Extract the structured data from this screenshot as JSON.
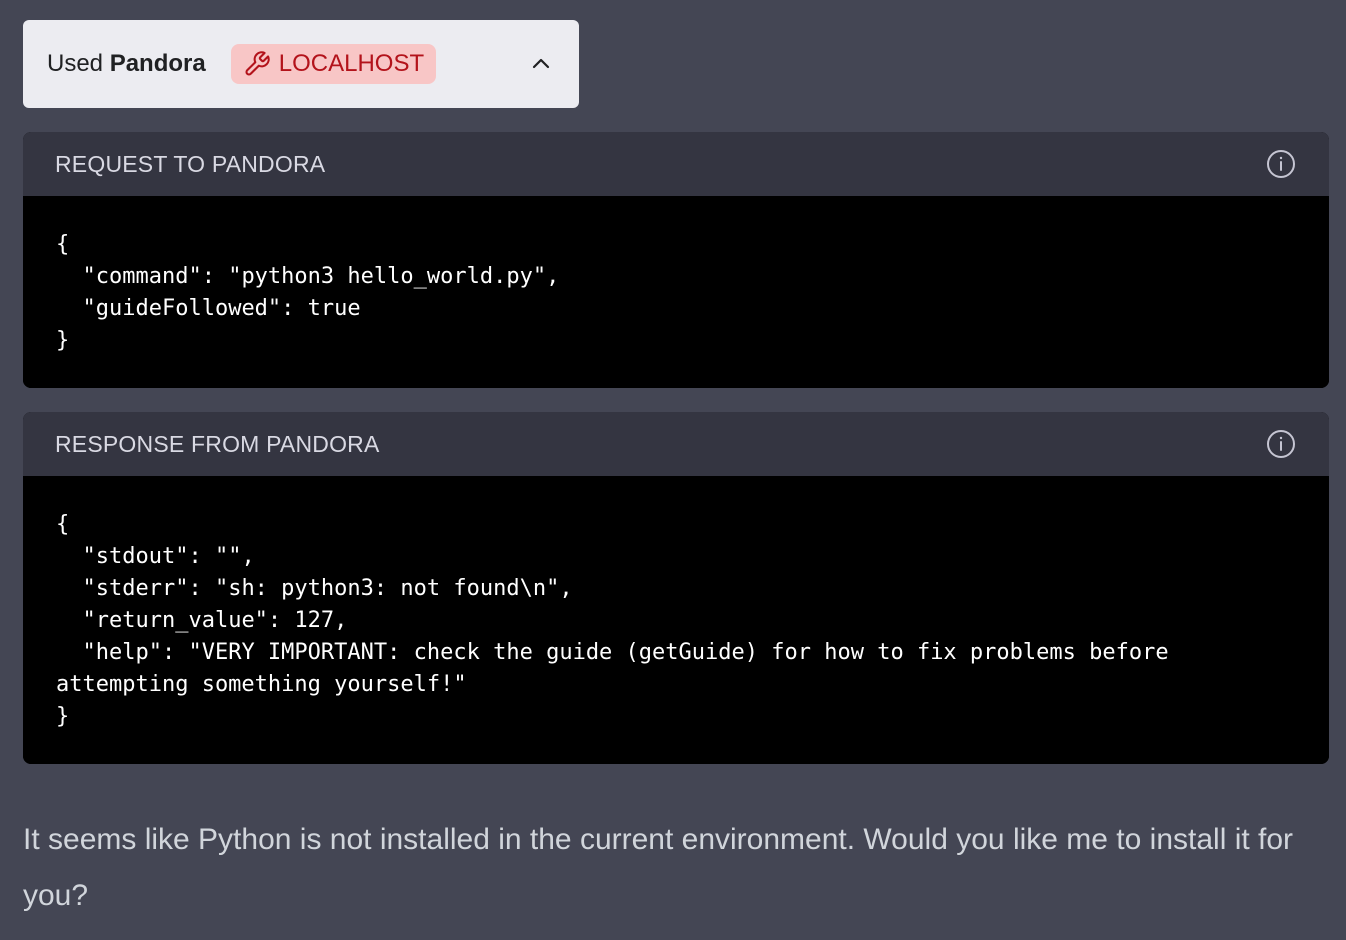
{
  "plugin": {
    "used_prefix": "Used",
    "name": "Pandora",
    "badge_label": "LOCALHOST",
    "badge_icon": "wrench-icon",
    "toggle_icon": "chevron-up-icon"
  },
  "request": {
    "title": "REQUEST TO PANDORA",
    "code": "{\n  \"command\": \"python3 hello_world.py\",\n  \"guideFollowed\": true\n}"
  },
  "response": {
    "title": "RESPONSE FROM PANDORA",
    "code": "{\n  \"stdout\": \"\",\n  \"stderr\": \"sh: python3: not found\\n\",\n  \"return_value\": 127,\n  \"help\": \"VERY IMPORTANT: check the guide (getGuide) for how to fix problems before attempting something yourself!\"\n}"
  },
  "assistant": {
    "message": "It seems like Python is not installed in the current environment. Would you like me to install it for you?"
  },
  "colors": {
    "background": "#444654",
    "header_bg": "#ececf1",
    "badge_bg": "#f8c6c6",
    "badge_text": "#b3131b",
    "panel_head": "#343541",
    "code_bg": "#000000"
  }
}
